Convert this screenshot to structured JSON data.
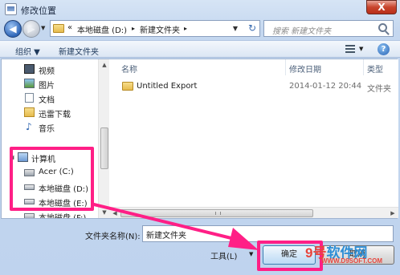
{
  "window": {
    "title": "修改位置",
    "close_label": "X"
  },
  "address": {
    "chevrons": "«",
    "segments": [
      "本地磁盘 (D:)",
      "新建文件夹"
    ],
    "sep": "▸"
  },
  "search": {
    "placeholder": "搜索 新建文件夹"
  },
  "toolbar": {
    "organize": "组织 ▼",
    "new_folder": "新建文件夹"
  },
  "nav": {
    "items": [
      {
        "label": "视频",
        "icon": "video-icon"
      },
      {
        "label": "图片",
        "icon": "pictures-icon"
      },
      {
        "label": "文档",
        "icon": "documents-icon"
      },
      {
        "label": "迅雷下载",
        "icon": "download-icon"
      },
      {
        "label": "音乐",
        "icon": "music-icon"
      },
      {
        "label": "计算机",
        "icon": "computer-icon"
      },
      {
        "label": "Acer (C:)",
        "icon": "system-drive-icon"
      },
      {
        "label": "本地磁盘 (D:)",
        "icon": "drive-icon"
      },
      {
        "label": "本地磁盘 (E:)",
        "icon": "drive-icon"
      },
      {
        "label": "本地磁盘 (F:)",
        "icon": "drive-icon"
      }
    ]
  },
  "files": {
    "columns": [
      "名称",
      "修改日期",
      "类型"
    ],
    "rows": [
      {
        "name": "Untitled Export",
        "date": "2014-01-12 20:44",
        "type": "文件夹"
      }
    ]
  },
  "footer": {
    "folder_name_label": "文件夹名称(N):",
    "folder_name_value": "新建文件夹",
    "tools": "工具(L)",
    "ok": "确定",
    "cancel": "取消"
  },
  "watermark": {
    "logo_a": "9号",
    "logo_b": "软件网",
    "url": "WWW.D9SOFT.COM"
  },
  "colors": {
    "highlight": "#ff1f86",
    "accent": "#3c7fb1"
  }
}
